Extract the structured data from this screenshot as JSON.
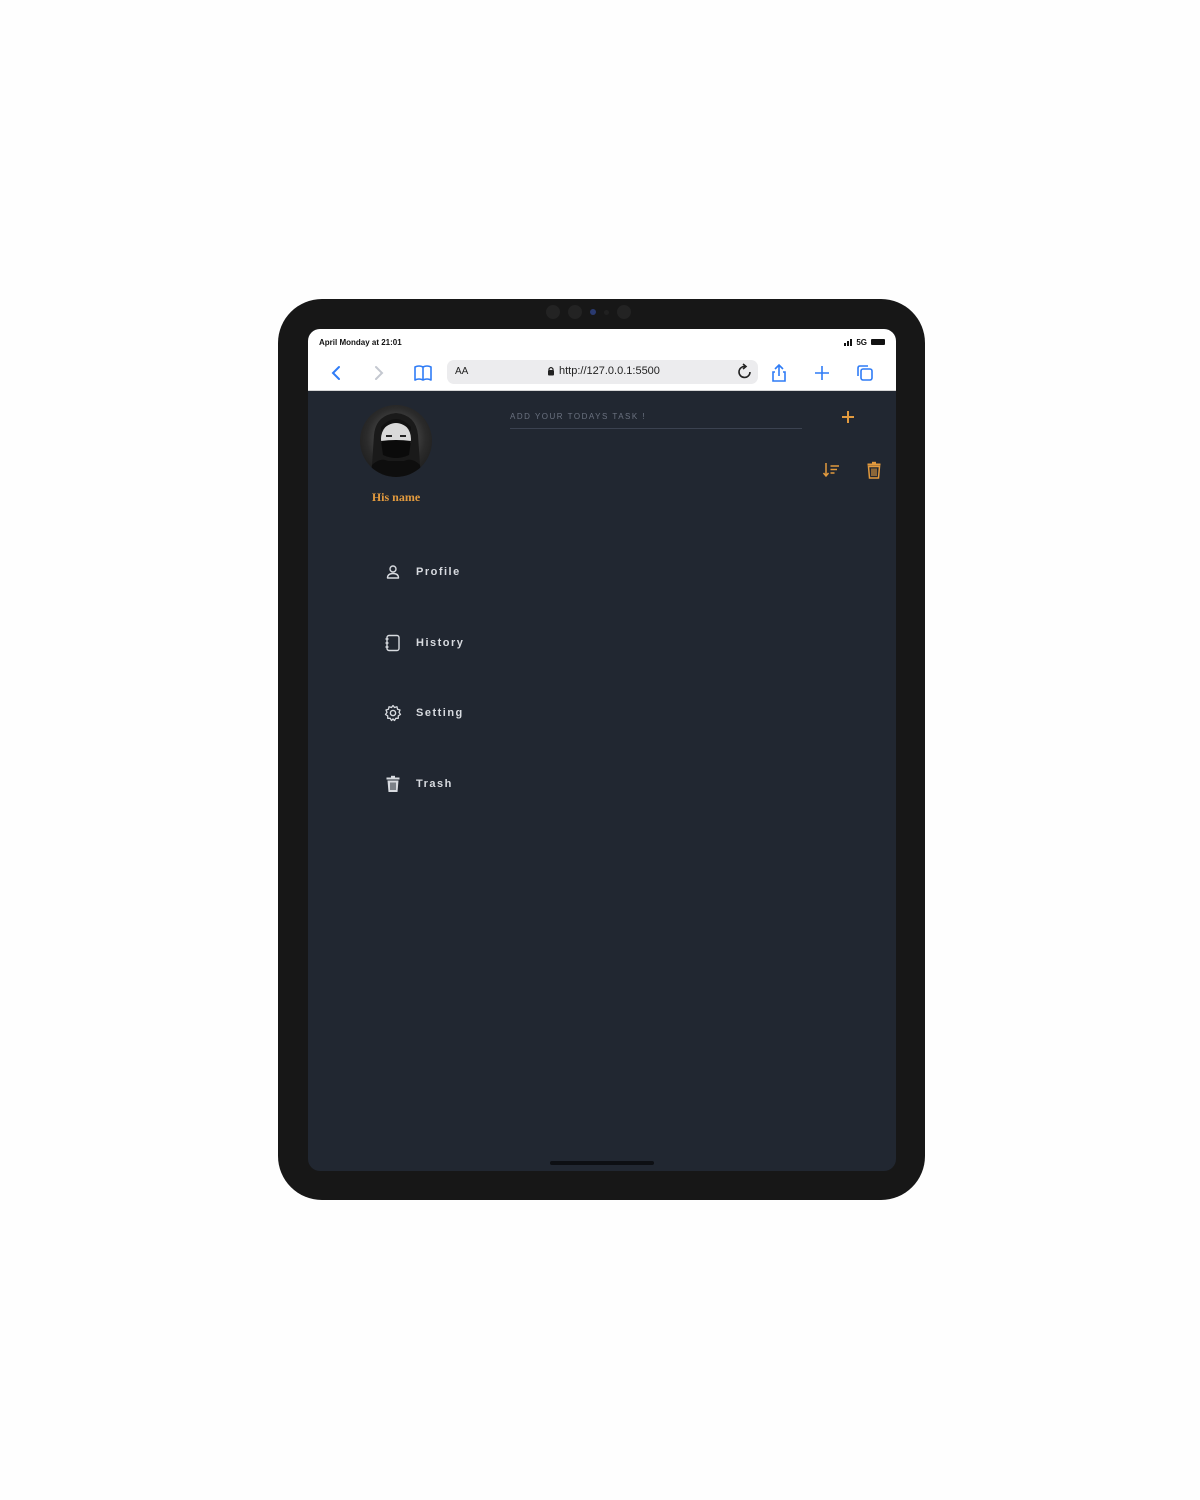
{
  "status_bar": {
    "time": "April Monday at 21:01",
    "network": "5G"
  },
  "browser": {
    "text_size_label": "AA",
    "url": "http://127.0.0.1:5500"
  },
  "sidebar": {
    "user_name": "His name",
    "items": [
      {
        "label": "Profile",
        "icon": "user-icon"
      },
      {
        "label": "History",
        "icon": "notebook-icon"
      },
      {
        "label": "Setting",
        "icon": "gear-icon"
      },
      {
        "label": "Trash",
        "icon": "trash-icon"
      }
    ]
  },
  "main": {
    "task_placeholder": "ADD YOUR TODAYS TASK !"
  },
  "colors": {
    "accent": "#e29a3e",
    "background": "#212731",
    "browser_blue": "#2f7cf6"
  }
}
